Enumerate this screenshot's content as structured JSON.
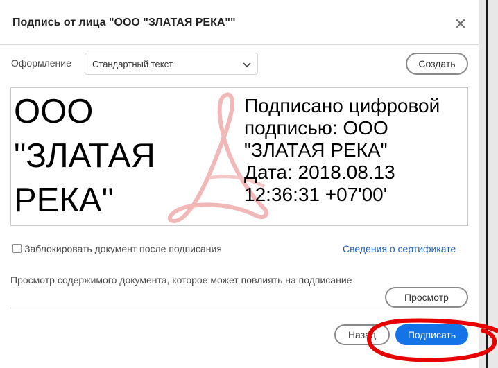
{
  "dialog": {
    "title": "Подпись от лица \"ООО \"ЗЛАТАЯ РЕКА\"\"",
    "close_icon": "close-icon"
  },
  "appearance": {
    "label": "Оформление",
    "selected": "Стандартный текст",
    "create_button": "Создать"
  },
  "signature_preview": {
    "name": "ООО\n\"ЗЛАТАЯ\nРЕКА\"",
    "lines": [
      "Подписано цифровой",
      "подписью: ООО",
      "\"ЗЛАТАЯ РЕКА\"",
      "Дата: 2018.08.13",
      "12:36:31 +07'00'"
    ],
    "watermark": "acrobat-logo"
  },
  "options": {
    "lock_label": "Заблокировать документ после подписания",
    "lock_checked": false,
    "cert_link": "Сведения о сертификате"
  },
  "review": {
    "label": "Просмотр содержимого документа, которое может повлиять на подписание",
    "view_button": "Просмотр"
  },
  "footer": {
    "back_button": "Назад",
    "sign_button": "Подписать"
  },
  "colors": {
    "primary": "#1473e6",
    "link": "#1d5fb3",
    "annotation": "#e60000",
    "watermark": "#f2b8b8"
  }
}
